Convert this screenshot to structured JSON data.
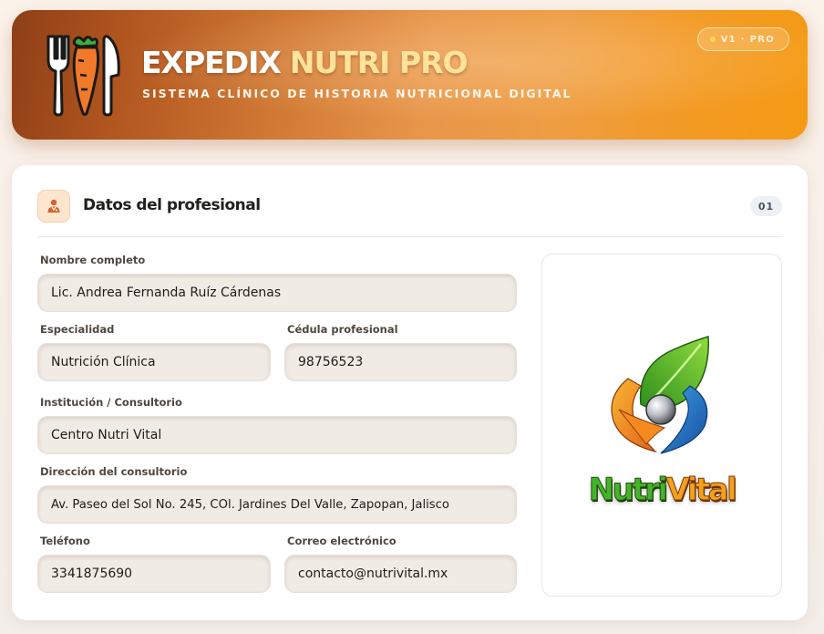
{
  "header": {
    "title_main": "EXPEDIX",
    "title_accent": "NUTRI PRO",
    "subtitle": "SISTEMA CLÍNICO DE HISTORIA NUTRICIONAL DIGITAL",
    "version_badge": "V1 · PRO",
    "brand_icon": "fork-carrot-knife-icon",
    "colors": {
      "banner_start": "#8e3f17",
      "banner_end": "#f59a14",
      "title_accent": "#ffe39a"
    }
  },
  "section": {
    "icon": "doctor-user-icon",
    "title": "Datos del profesional",
    "number": "01"
  },
  "form": {
    "nombre": {
      "label": "Nombre completo",
      "value": "Lic. Andrea Fernanda Ruíz Cárdenas"
    },
    "especialidad": {
      "label": "Especialidad",
      "value": "Nutrición Clínica"
    },
    "cedula": {
      "label": "Cédula profesional",
      "value": "98756523"
    },
    "institucion": {
      "label": "Institución / Consultorio",
      "value": "Centro Nutri Vital"
    },
    "direccion": {
      "label": "Dirección del consultorio",
      "value": "Av. Paseo del Sol No. 245, COl. Jardines Del Valle, Zapopan, Jalisco"
    },
    "telefono": {
      "label": "Teléfono",
      "value": "3341875690"
    },
    "correo": {
      "label": "Correo electrónico",
      "value": "contacto@nutrivital.mx"
    }
  },
  "logo": {
    "icon": "nutrivital-leaf-swirl-logo",
    "text_part1": "Nutri",
    "text_part2": "Vital",
    "colors": {
      "green": "#42b52b",
      "orange": "#f4a01c",
      "blue": "#1f6fc4"
    }
  }
}
